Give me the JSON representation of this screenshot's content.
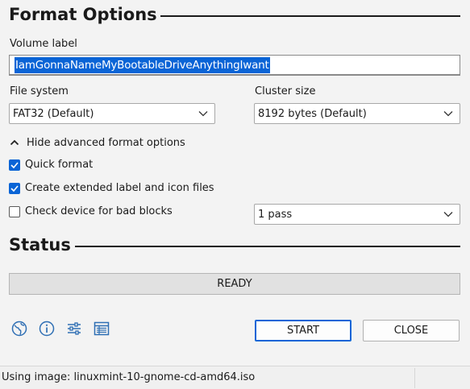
{
  "format_options": {
    "title": "Format Options",
    "volume_label": {
      "label": "Volume label",
      "value": "IamGonnaNameMyBootableDriveAnythingIwant"
    },
    "file_system": {
      "label": "File system",
      "selected": "FAT32 (Default)"
    },
    "cluster_size": {
      "label": "Cluster size",
      "selected": "8192 bytes (Default)"
    },
    "advanced_toggle_label": "Hide advanced format options",
    "quick_format": {
      "label": "Quick format",
      "checked": true
    },
    "extended_label": {
      "label": "Create extended label and icon files",
      "checked": true
    },
    "bad_blocks": {
      "label": "Check device for bad blocks",
      "checked": false,
      "passes": "1 pass"
    }
  },
  "status": {
    "title": "Status",
    "progress_text": "READY",
    "progress_fraction": 0
  },
  "toolbar": {
    "icons": [
      "globe-icon",
      "info-icon",
      "settings-sliders-icon",
      "log-icon"
    ]
  },
  "actions": {
    "start_label": "START",
    "close_label": "CLOSE"
  },
  "footer": {
    "status_text": "Using image: linuxmint-10-gnome-cd-amd64.iso"
  },
  "colors": {
    "accent": "#0a64d6",
    "background": "#f3f3f3",
    "progress_bg": "#e1e1e1"
  }
}
